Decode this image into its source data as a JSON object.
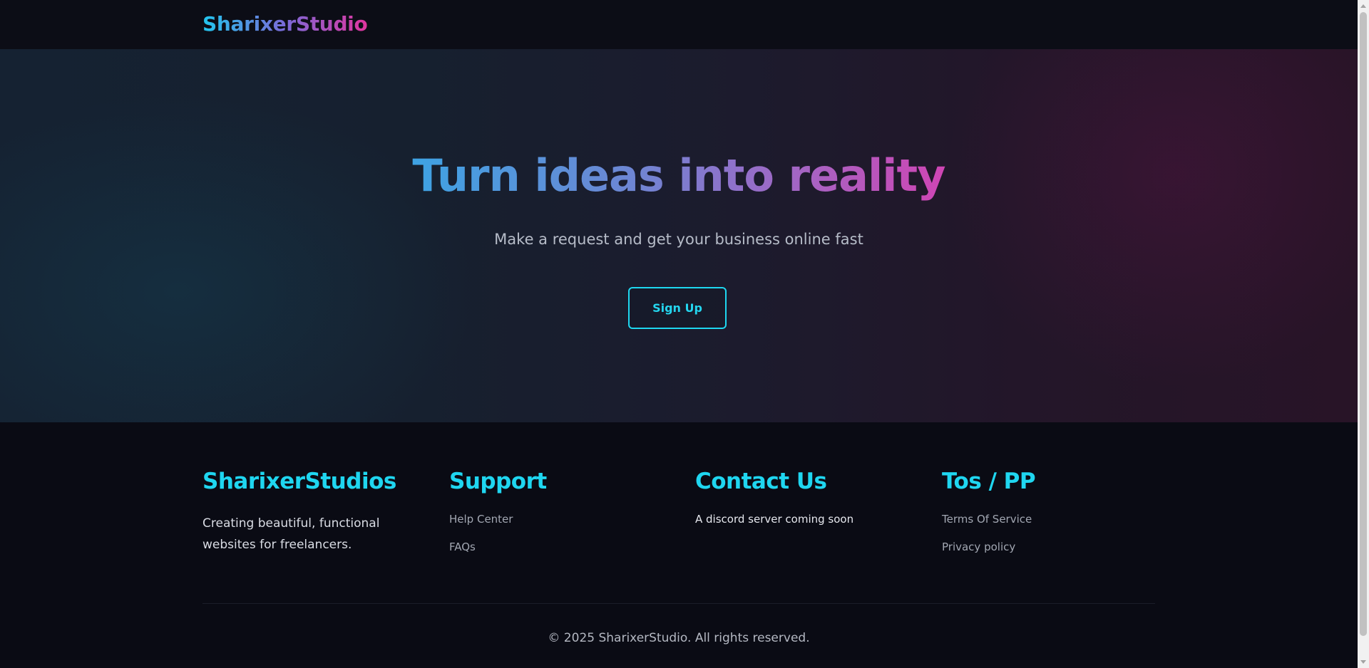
{
  "navbar": {
    "logo": "SharixerStudio"
  },
  "hero": {
    "title": "Turn ideas into reality",
    "subtitle": "Make a request and get your business online fast",
    "button_label": "Sign Up"
  },
  "footer": {
    "brand": {
      "heading": "SharixerStudios",
      "description": "Creating beautiful, functional websites for freelancers."
    },
    "support": {
      "heading": "Support",
      "links": [
        "Help Center",
        "FAQs"
      ]
    },
    "contact": {
      "heading": "Contact Us",
      "text": "A discord server coming soon"
    },
    "legal": {
      "heading": "Tos / PP",
      "links": [
        "Terms Of Service",
        "Privacy policy"
      ]
    },
    "copyright": "© 2025 SharixerStudio. All rights reserved."
  },
  "colors": {
    "accent": "#1fd6f0",
    "brand_pink": "#e0359f",
    "background": "#0a0b14"
  }
}
